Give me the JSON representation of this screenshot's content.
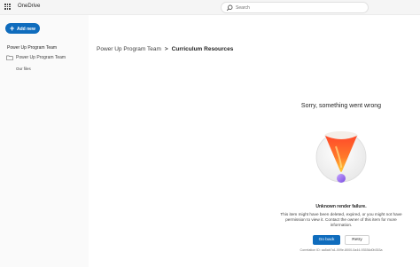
{
  "app": {
    "title": "OneDrive"
  },
  "search": {
    "placeholder": "Search"
  },
  "sidebar": {
    "add_new_label": "Add new",
    "header": "Power Up Program Team",
    "items": [
      {
        "label": "Power Up Program Team",
        "icon": "folder-icon"
      }
    ],
    "sub_items": [
      {
        "label": "Our files"
      }
    ]
  },
  "breadcrumb": {
    "parent": "Power Up Program Team",
    "separator": ">",
    "current": "Curriculum Resources"
  },
  "error": {
    "title": "Sorry, something went wrong",
    "subtitle": "Unknown render failure.",
    "description": "This item might have been deleted, expired, or you might not have permission to view it. Contact the owner of this item for more information.",
    "primary_button": "Go back",
    "secondary_button": "Retry",
    "correlation": "Correlation ID: aa5ab7a1-009e-8000-0a44-93536d0b353a"
  },
  "colors": {
    "accent": "#0f6cbd",
    "topbar": "#f5f5f5"
  }
}
